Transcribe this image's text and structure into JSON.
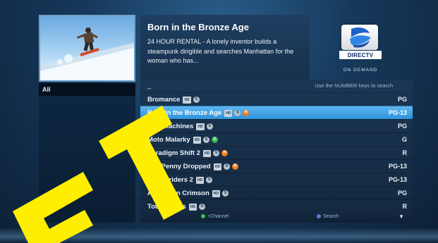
{
  "left": {
    "filter_label": "All"
  },
  "info": {
    "title": "Born in the Bronze Age",
    "description": "24 HOUR RENTAL - A lonely inventor builds a steampunk dirigible and searches Manhattan for the woman who has..."
  },
  "brand": {
    "name": "DIRECTV",
    "sub": "ON DEMAND"
  },
  "search": {
    "current_value": "_",
    "hint": "Use the NUMBER keys to search"
  },
  "list": [
    {
      "title": "Bromance",
      "badges": [
        "HD"
      ],
      "icons": [
        "S"
      ],
      "rating": "PG",
      "selected": false
    },
    {
      "title": "Born in the Bronze Age",
      "badges": [
        "HD"
      ],
      "icons": [
        "S",
        "R"
      ],
      "rating": "PG-13",
      "selected": true
    },
    {
      "title": "Fast Machines",
      "badges": [
        "HD"
      ],
      "icons": [
        "S"
      ],
      "rating": "PG",
      "selected": false
    },
    {
      "title": "Moto Malarky",
      "badges": [
        "HD"
      ],
      "icons": [
        "S",
        "G"
      ],
      "rating": "G",
      "selected": false
    },
    {
      "title": "Paradigm Shift 2",
      "badges": [
        "HD"
      ],
      "icons": [
        "S",
        "R"
      ],
      "rating": "R",
      "selected": false
    },
    {
      "title": "The Penny Dropped",
      "badges": [
        "HD"
      ],
      "icons": [
        "S",
        "R"
      ],
      "rating": "PG-13",
      "selected": false
    },
    {
      "title": "Broomriders 2",
      "badges": [
        "HD"
      ],
      "icons": [
        "S"
      ],
      "rating": "PG-13",
      "selected": false
    },
    {
      "title": "A Study in Crimson",
      "badges": [
        "HD"
      ],
      "icons": [
        "S"
      ],
      "rating": "PG",
      "selected": false
    },
    {
      "title": "Tough Guys",
      "badges": [
        "HD"
      ],
      "icons": [
        "S"
      ],
      "rating": "R",
      "selected": false
    }
  ],
  "footer": {
    "green_label": "+Channel",
    "blue_label": "Search",
    "green_color": "#3ebd4f",
    "blue_color": "#5c78d6",
    "arrow_icon": "chevron-down-icon"
  },
  "colors": {
    "selected_row": "#3a9ce0",
    "watermark": "#ffee00"
  },
  "watermark_text": "FT"
}
